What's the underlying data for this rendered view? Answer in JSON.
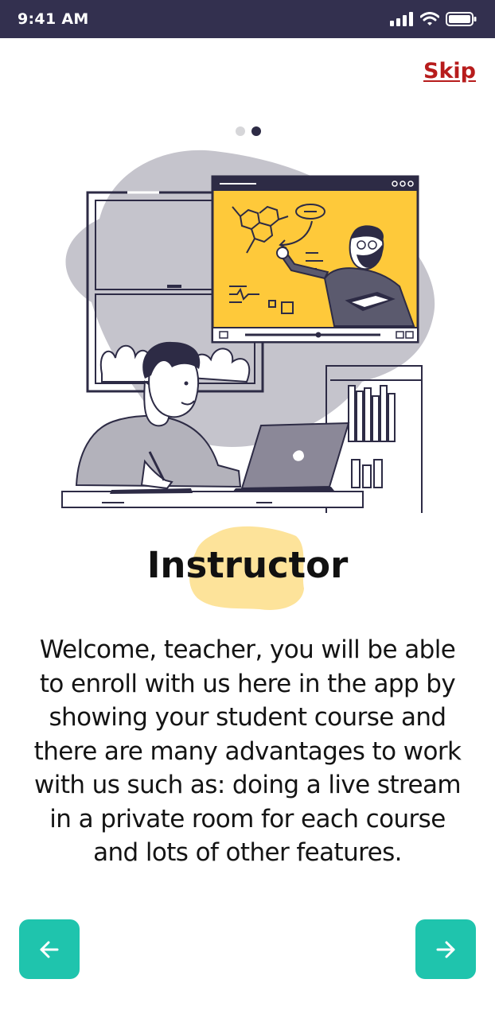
{
  "status_bar": {
    "time": "9:41 AM",
    "icons": [
      "signal-icon",
      "wifi-icon",
      "battery-icon"
    ]
  },
  "header": {
    "skip_label": "Skip"
  },
  "pagination": {
    "total": 2,
    "current": 2
  },
  "illustration": {
    "name": "student-watching-online-lecture"
  },
  "onboarding": {
    "title": "Instructor",
    "description": "Welcome, teacher, you will be able to enroll with us here in the app by showing your student course and there are many advantages to work with us such as: doing a live stream in a private room for each course and lots of other features."
  },
  "navigation": {
    "prev_icon": "arrow-left-icon",
    "next_icon": "arrow-right-icon"
  },
  "colors": {
    "status_bar": "#33304f",
    "skip": "#b71c1c",
    "accent": "#1fc4ad",
    "dot_active": "#2d2b45",
    "dot_inactive": "#d6d6d9",
    "highlight": "#fde39a",
    "screen_yellow": "#fec93a"
  }
}
